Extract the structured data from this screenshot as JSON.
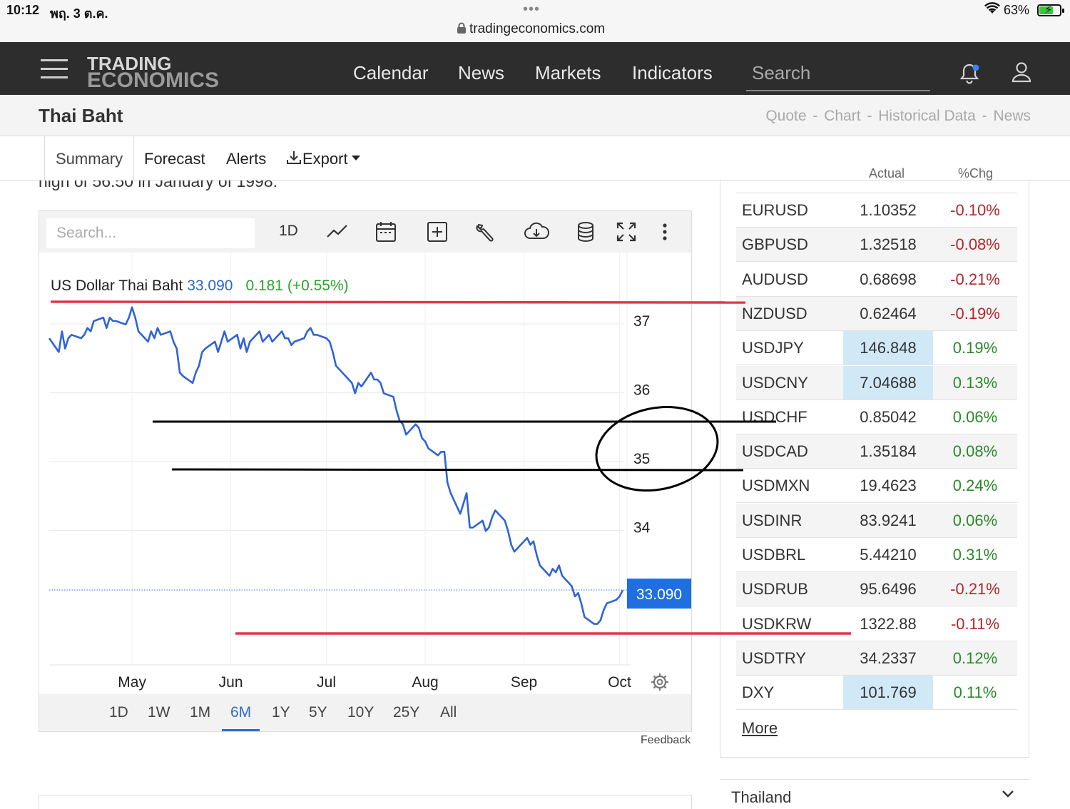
{
  "status_bar": {
    "time": "10:12",
    "date": "พฤ. 3 ต.ค.",
    "url": "tradingeconomics.com",
    "battery": "63%"
  },
  "nav": {
    "logo_line1": "TRADING",
    "logo_line2": "ECONOMICS",
    "links": [
      "Calendar",
      "News",
      "Markets",
      "Indicators"
    ],
    "search_placeholder": "Search"
  },
  "page": {
    "title": "Thai Baht",
    "links": [
      "Quote",
      "Chart",
      "Historical Data",
      "News"
    ],
    "cutoff_text": "high of 56.50 in January of 1998."
  },
  "tabs": [
    "Summary",
    "Forecast",
    "Alerts",
    "Export"
  ],
  "chart_toolbar": {
    "search_placeholder": "Search...",
    "interval": "1D"
  },
  "chart_header": {
    "name": "US Dollar Thai Baht",
    "price": "33.090",
    "change": "0.181 (+0.55%)"
  },
  "chart_data": {
    "type": "line",
    "series": [
      {
        "name": "US Dollar Thai Baht",
        "color": "#2f63d6",
        "values": [
          [
            "2024-04-05",
            36.75
          ],
          [
            "2024-04-08",
            36.55
          ],
          [
            "2024-04-09",
            36.85
          ],
          [
            "2024-04-10",
            36.6
          ],
          [
            "2024-04-11",
            36.75
          ],
          [
            "2024-04-12",
            36.8
          ],
          [
            "2024-04-15",
            36.75
          ],
          [
            "2024-04-16",
            36.8
          ],
          [
            "2024-04-17",
            36.9
          ],
          [
            "2024-04-18",
            36.85
          ],
          [
            "2024-04-19",
            37.0
          ],
          [
            "2024-04-22",
            37.05
          ],
          [
            "2024-04-23",
            36.9
          ],
          [
            "2024-04-24",
            37.05
          ],
          [
            "2024-04-25",
            37.0
          ],
          [
            "2024-04-26",
            37.0
          ],
          [
            "2024-04-29",
            36.95
          ],
          [
            "2024-04-30",
            37.05
          ],
          [
            "2024-05-01",
            37.2
          ],
          [
            "2024-05-02",
            37.05
          ],
          [
            "2024-05-03",
            36.85
          ],
          [
            "2024-05-06",
            36.7
          ],
          [
            "2024-05-07",
            36.85
          ],
          [
            "2024-05-08",
            36.75
          ],
          [
            "2024-05-09",
            36.9
          ],
          [
            "2024-05-10",
            36.8
          ],
          [
            "2024-05-13",
            36.85
          ],
          [
            "2024-05-14",
            36.7
          ],
          [
            "2024-05-15",
            36.6
          ],
          [
            "2024-05-16",
            36.25
          ],
          [
            "2024-05-17",
            36.2
          ],
          [
            "2024-05-20",
            36.1
          ],
          [
            "2024-05-21",
            36.25
          ],
          [
            "2024-05-22",
            36.35
          ],
          [
            "2024-05-23",
            36.55
          ],
          [
            "2024-05-24",
            36.6
          ],
          [
            "2024-05-27",
            36.7
          ],
          [
            "2024-05-28",
            36.55
          ],
          [
            "2024-05-29",
            36.7
          ],
          [
            "2024-05-30",
            36.85
          ],
          [
            "2024-05-31",
            36.7
          ],
          [
            "2024-06-03",
            36.8
          ],
          [
            "2024-06-04",
            36.6
          ],
          [
            "2024-06-05",
            36.75
          ],
          [
            "2024-06-06",
            36.55
          ],
          [
            "2024-06-07",
            36.7
          ],
          [
            "2024-06-10",
            36.85
          ],
          [
            "2024-06-11",
            36.7
          ],
          [
            "2024-06-12",
            36.75
          ],
          [
            "2024-06-13",
            36.8
          ],
          [
            "2024-06-14",
            36.7
          ],
          [
            "2024-06-17",
            36.85
          ],
          [
            "2024-06-18",
            36.75
          ],
          [
            "2024-06-19",
            36.75
          ],
          [
            "2024-06-20",
            36.65
          ],
          [
            "2024-06-21",
            36.7
          ],
          [
            "2024-06-24",
            36.75
          ],
          [
            "2024-06-25",
            36.85
          ],
          [
            "2024-06-26",
            36.9
          ],
          [
            "2024-06-27",
            36.8
          ],
          [
            "2024-06-28",
            36.8
          ],
          [
            "2024-07-01",
            36.75
          ],
          [
            "2024-07-02",
            36.7
          ],
          [
            "2024-07-03",
            36.55
          ],
          [
            "2024-07-04",
            36.35
          ],
          [
            "2024-07-05",
            36.3
          ],
          [
            "2024-07-08",
            36.15
          ],
          [
            "2024-07-09",
            36.1
          ],
          [
            "2024-07-10",
            35.95
          ],
          [
            "2024-07-11",
            36.1
          ],
          [
            "2024-07-12",
            36.05
          ],
          [
            "2024-07-15",
            36.25
          ],
          [
            "2024-07-16",
            36.15
          ],
          [
            "2024-07-17",
            36.15
          ],
          [
            "2024-07-18",
            36.1
          ],
          [
            "2024-07-19",
            35.95
          ],
          [
            "2024-07-22",
            35.9
          ],
          [
            "2024-07-23",
            35.7
          ],
          [
            "2024-07-24",
            35.55
          ],
          [
            "2024-07-25",
            35.5
          ],
          [
            "2024-07-26",
            35.35
          ],
          [
            "2024-07-29",
            35.5
          ],
          [
            "2024-07-30",
            35.45
          ],
          [
            "2024-07-31",
            35.3
          ],
          [
            "2024-08-01",
            35.25
          ],
          [
            "2024-08-02",
            35.15
          ],
          [
            "2024-08-05",
            35.05
          ],
          [
            "2024-08-06",
            35.1
          ],
          [
            "2024-08-07",
            35.1
          ],
          [
            "2024-08-08",
            34.65
          ],
          [
            "2024-08-09",
            34.5
          ],
          [
            "2024-08-12",
            34.2
          ],
          [
            "2024-08-13",
            34.35
          ],
          [
            "2024-08-14",
            34.5
          ],
          [
            "2024-08-15",
            34.0
          ],
          [
            "2024-08-16",
            34.0
          ],
          [
            "2024-08-19",
            34.1
          ],
          [
            "2024-08-20",
            33.95
          ],
          [
            "2024-08-21",
            34.0
          ],
          [
            "2024-08-22",
            34.15
          ],
          [
            "2024-08-23",
            34.25
          ],
          [
            "2024-08-26",
            34.1
          ],
          [
            "2024-08-27",
            33.95
          ],
          [
            "2024-08-28",
            33.75
          ],
          [
            "2024-08-29",
            33.65
          ],
          [
            "2024-08-30",
            33.7
          ],
          [
            "2024-09-02",
            33.85
          ],
          [
            "2024-09-03",
            33.75
          ],
          [
            "2024-09-04",
            33.8
          ],
          [
            "2024-09-05",
            33.6
          ],
          [
            "2024-09-06",
            33.45
          ],
          [
            "2024-09-09",
            33.3
          ],
          [
            "2024-09-10",
            33.4
          ],
          [
            "2024-09-11",
            33.35
          ],
          [
            "2024-09-12",
            33.45
          ],
          [
            "2024-09-13",
            33.3
          ],
          [
            "2024-09-16",
            33.15
          ],
          [
            "2024-09-17",
            33.0
          ],
          [
            "2024-09-18",
            33.05
          ],
          [
            "2024-09-19",
            32.9
          ],
          [
            "2024-09-20",
            32.7
          ],
          [
            "2024-09-23",
            32.6
          ],
          [
            "2024-09-24",
            32.6
          ],
          [
            "2024-09-25",
            32.65
          ],
          [
            "2024-09-26",
            32.8
          ],
          [
            "2024-09-27",
            32.9
          ],
          [
            "2024-09-30",
            32.95
          ],
          [
            "2024-10-01",
            33.0
          ],
          [
            "2024-10-02",
            33.09
          ]
        ]
      }
    ],
    "x_ticks": [
      "May",
      "Jun",
      "Jul",
      "Aug",
      "Sep",
      "Oct"
    ],
    "y_ticks": [
      "37",
      "36",
      "35",
      "34"
    ],
    "current_value_label": "33.090",
    "grid": true
  },
  "range_buttons": [
    "1D",
    "1W",
    "1M",
    "6M",
    "1Y",
    "5Y",
    "10Y",
    "25Y",
    "All"
  ],
  "range_active": "6M",
  "feedback": "Feedback",
  "table": {
    "headers": [
      "Actual",
      "%Chg"
    ],
    "rows": [
      {
        "sym": "EURUSD",
        "actual": "1.10352",
        "chg": "-0.10%",
        "hl": false
      },
      {
        "sym": "GBPUSD",
        "actual": "1.32518",
        "chg": "-0.08%",
        "hl": false
      },
      {
        "sym": "AUDUSD",
        "actual": "0.68698",
        "chg": "-0.21%",
        "hl": false
      },
      {
        "sym": "NZDUSD",
        "actual": "0.62464",
        "chg": "-0.19%",
        "hl": false
      },
      {
        "sym": "USDJPY",
        "actual": "146.848",
        "chg": "0.19%",
        "hl": true
      },
      {
        "sym": "USDCNY",
        "actual": "7.04688",
        "chg": "0.13%",
        "hl": true
      },
      {
        "sym": "USDCHF",
        "actual": "0.85042",
        "chg": "0.06%",
        "hl": false
      },
      {
        "sym": "USDCAD",
        "actual": "1.35184",
        "chg": "0.08%",
        "hl": false
      },
      {
        "sym": "USDMXN",
        "actual": "19.4623",
        "chg": "0.24%",
        "hl": false
      },
      {
        "sym": "USDINR",
        "actual": "83.9241",
        "chg": "0.06%",
        "hl": false
      },
      {
        "sym": "USDBRL",
        "actual": "5.44210",
        "chg": "0.31%",
        "hl": false
      },
      {
        "sym": "USDRUB",
        "actual": "95.6496",
        "chg": "-0.21%",
        "hl": false
      },
      {
        "sym": "USDKRW",
        "actual": "1322.88",
        "chg": "-0.11%",
        "hl": false
      },
      {
        "sym": "USDTRY",
        "actual": "34.2337",
        "chg": "0.12%",
        "hl": false
      },
      {
        "sym": "DXY",
        "actual": "101.769",
        "chg": "0.11%",
        "hl": true
      }
    ],
    "more_label": "More"
  },
  "section_thailand": "Thailand",
  "colors": {
    "nav_bg": "#2d2d2d",
    "line": "#2f63d6",
    "annotation_red": "#e0384b",
    "annotation_black": "#000000",
    "positive": "#2a8a2a",
    "negative": "#b3262a",
    "highlight": "#d1e9f7",
    "accent": "#2f6bd0"
  }
}
